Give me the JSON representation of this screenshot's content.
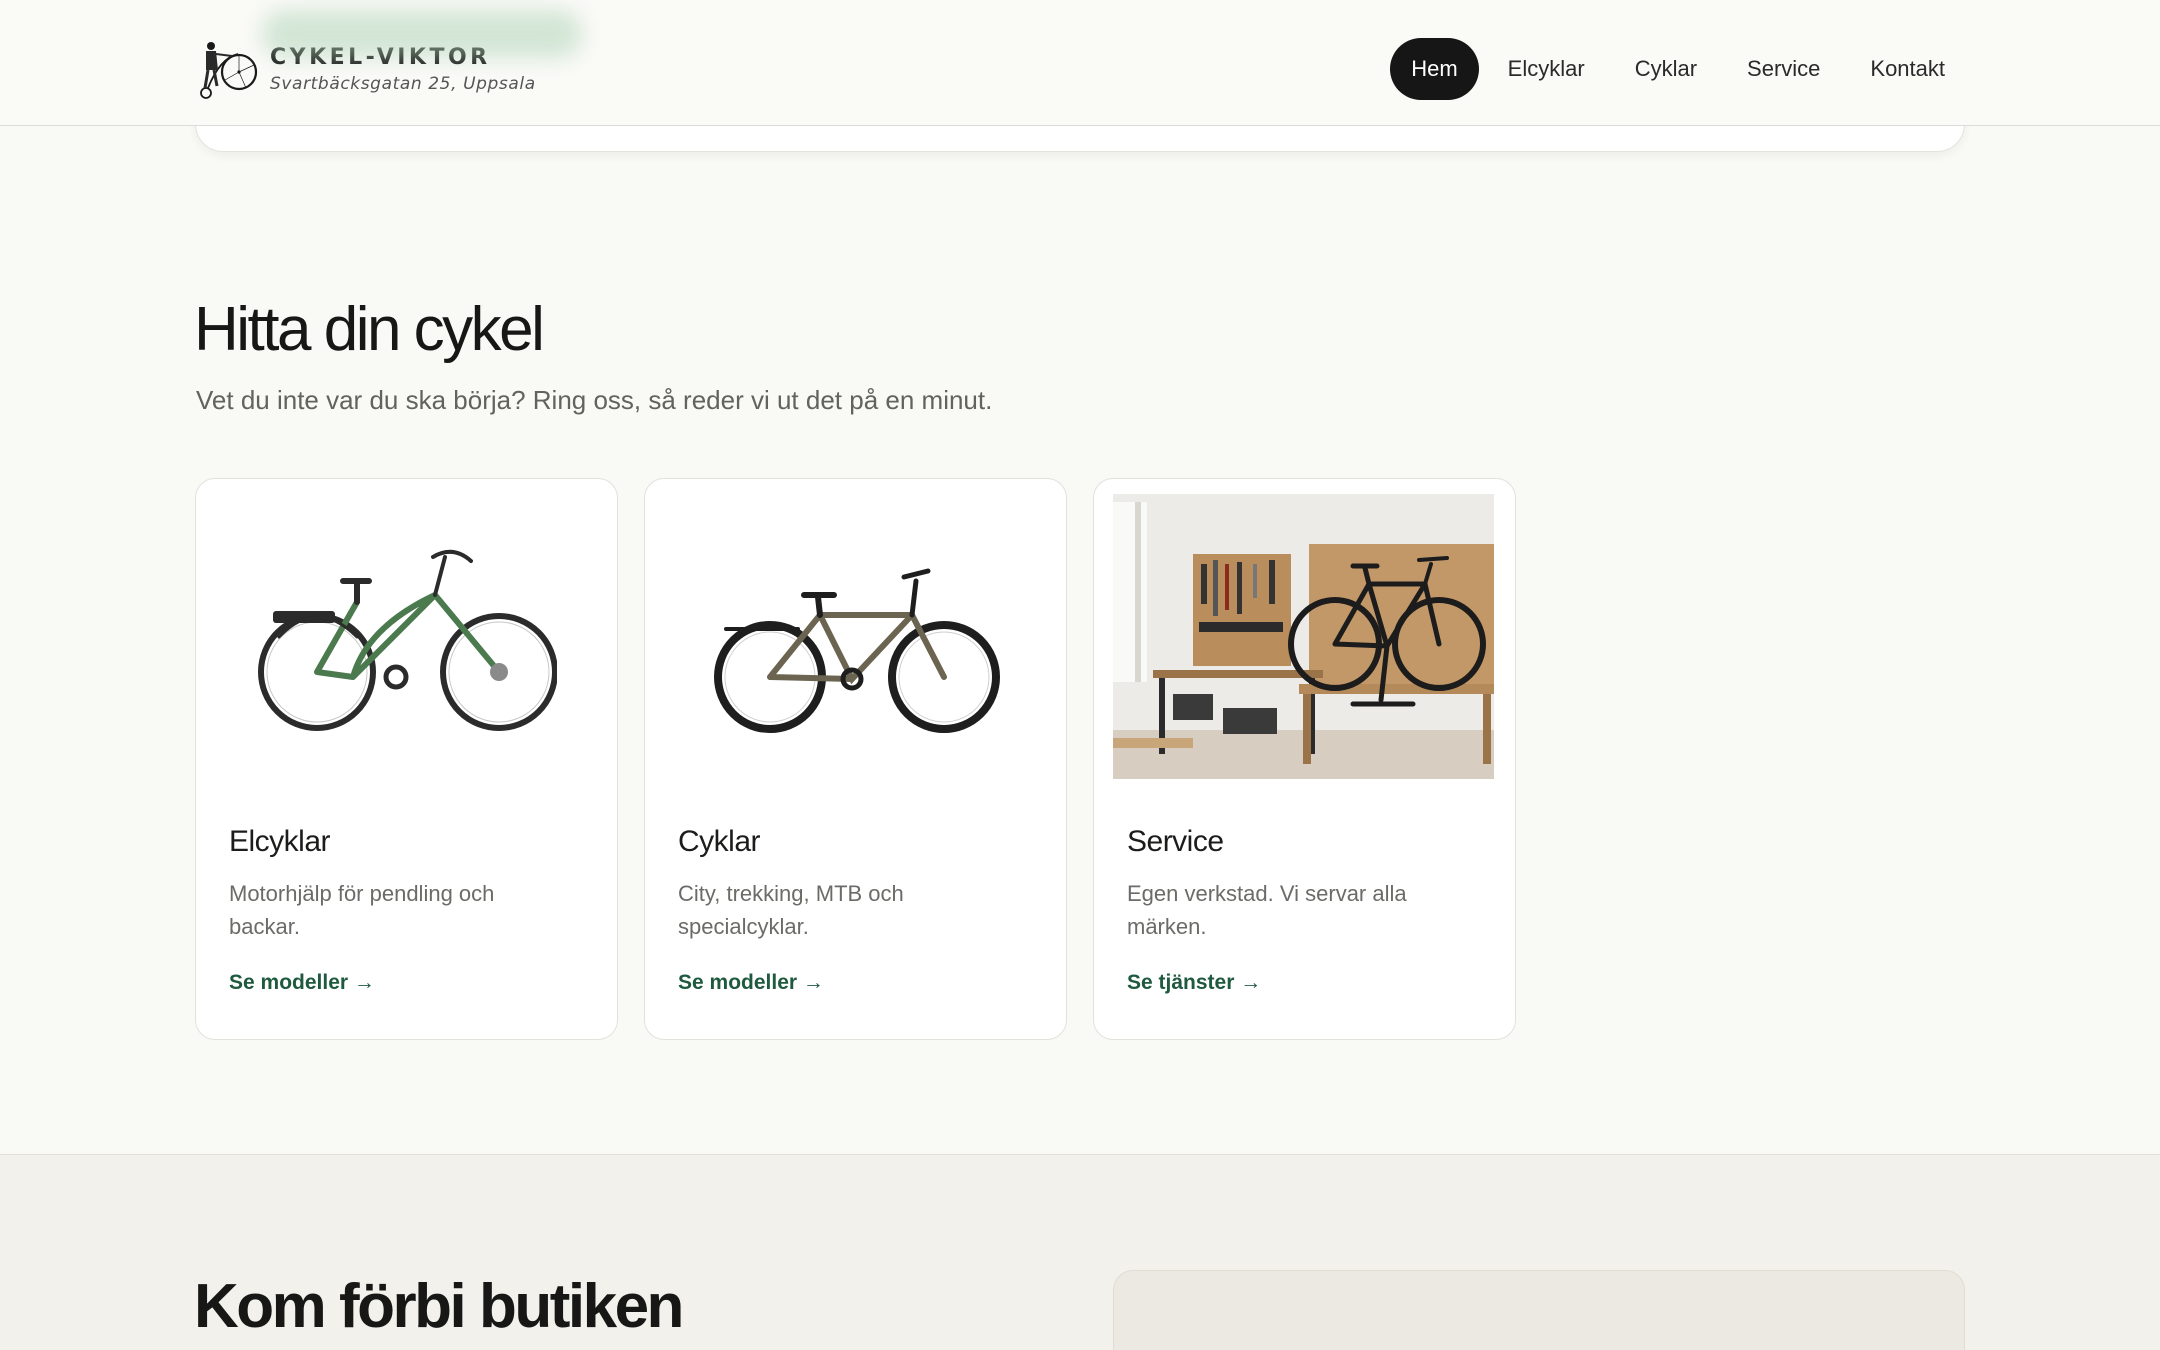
{
  "brand": {
    "name": "CYKEL-VIKTOR",
    "address": "Svartbäcksgatan 25, Uppsala",
    "logo_icon": "penny-farthing-rider-icon"
  },
  "nav": {
    "items": [
      {
        "label": "Hem",
        "active": true
      },
      {
        "label": "Elcyklar",
        "active": false
      },
      {
        "label": "Cyklar",
        "active": false
      },
      {
        "label": "Service",
        "active": false
      },
      {
        "label": "Kontakt",
        "active": false
      }
    ]
  },
  "find": {
    "title": "Hitta din cykel",
    "subtitle": "Vet du inte var du ska börja? Ring oss, så reder vi ut det på en minut."
  },
  "cards": [
    {
      "title": "Elcyklar",
      "description": "Motorhjälp för pendling och backar.",
      "link": "Se modeller →",
      "image": "green-e-bike-icon",
      "frame_color": "#4c7a4f"
    },
    {
      "title": "Cyklar",
      "description": "City, trekking, MTB och specialcyklar.",
      "link": "Se modeller →",
      "image": "city-bike-icon",
      "frame_color": "#6b6450"
    },
    {
      "title": "Service",
      "description": "Egen verkstad. Vi servar alla märken.",
      "link": "Se tjänster →",
      "image": "workshop-photo",
      "frame_color": "#222222"
    }
  ],
  "visit": {
    "title": "Kom förbi butiken"
  }
}
